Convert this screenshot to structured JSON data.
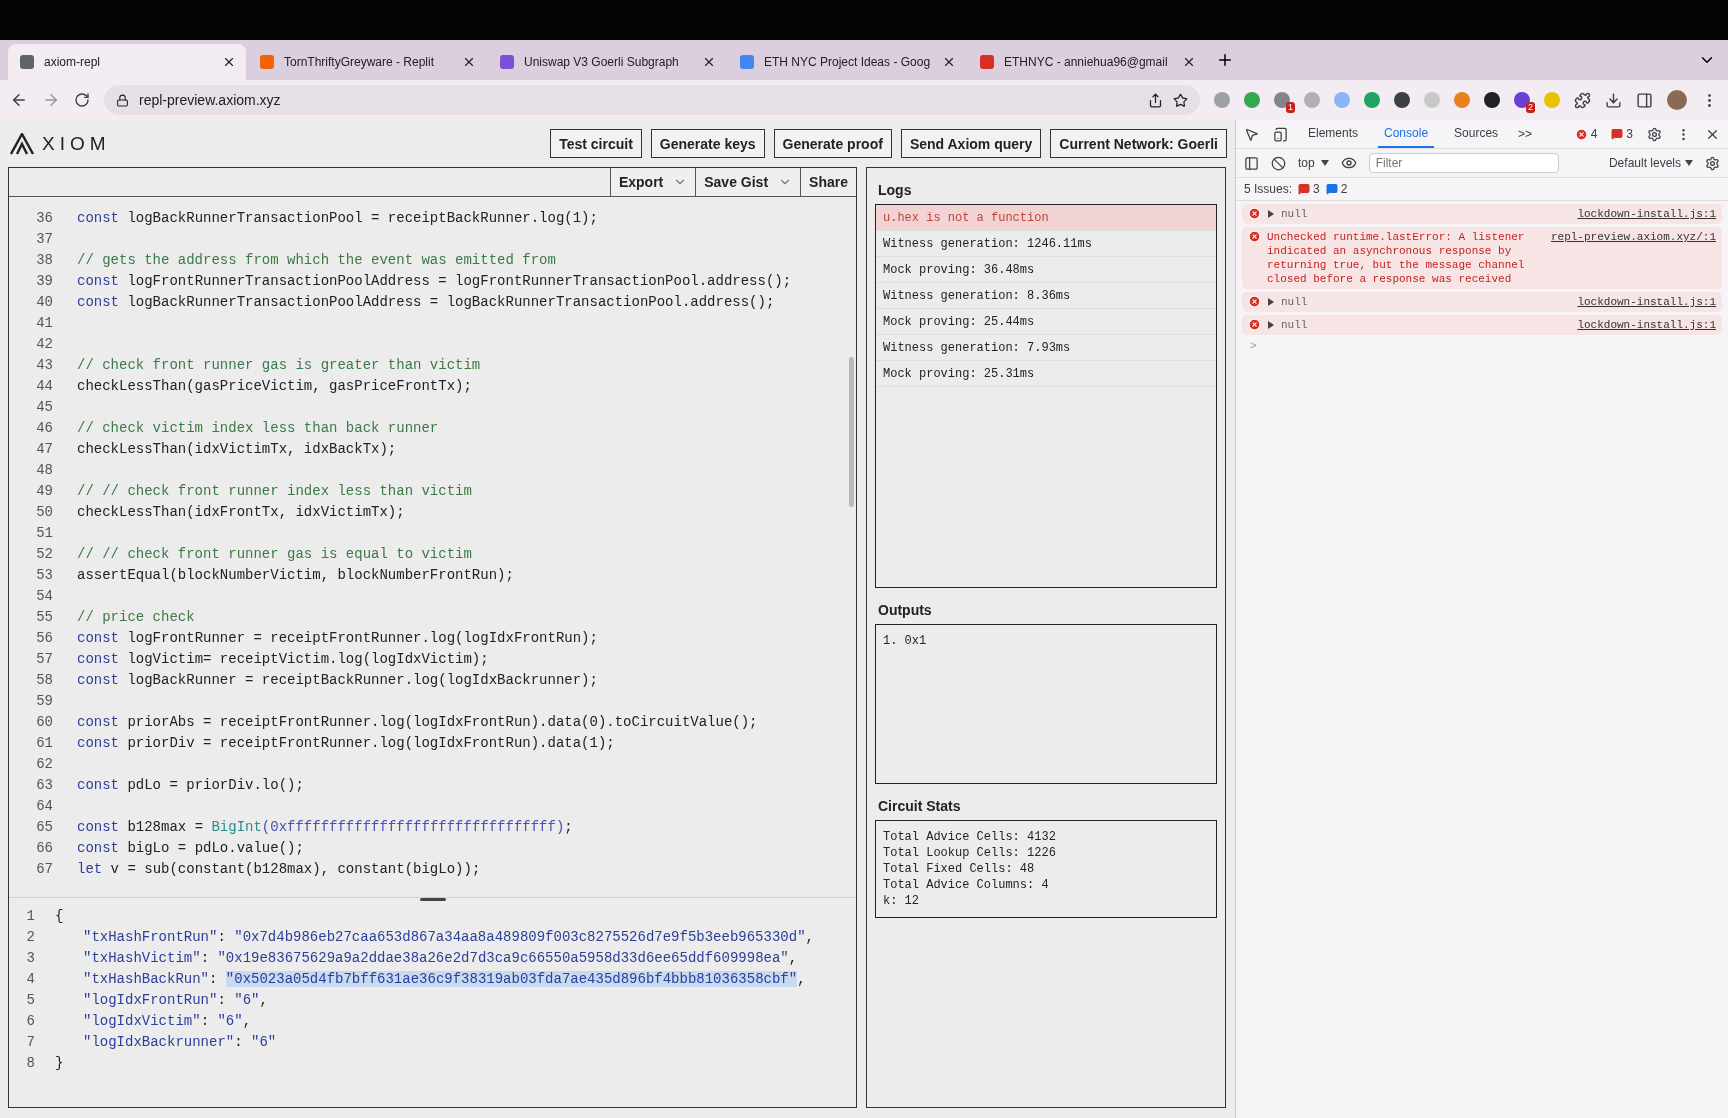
{
  "browser": {
    "tabs": [
      {
        "title": "axiom-repl",
        "selected": true,
        "color": "#5f6368"
      },
      {
        "title": "TornThriftyGreyware - Replit",
        "selected": false,
        "color": "#f26207"
      },
      {
        "title": "Uniswap V3 Goerli Subgraph",
        "selected": false,
        "color": "#7b4fd6"
      },
      {
        "title": "ETH NYC Project Ideas - Goog",
        "selected": false,
        "color": "#4285f4"
      },
      {
        "title": "ETHNYC - anniehua96@gmail",
        "selected": false,
        "color": "#d93025"
      }
    ],
    "url": "repl-preview.axiom.xyz",
    "extensions": [
      {
        "color": "#9aa0a6"
      },
      {
        "color": "#34a853"
      },
      {
        "color": "#80868b",
        "badge": "1"
      },
      {
        "color": "#b0b0b0"
      },
      {
        "color": "#8ab4f8"
      },
      {
        "color": "#1ea362"
      },
      {
        "color": "#3c4043"
      },
      {
        "color": "#c8c8c8"
      },
      {
        "color": "#e8821e"
      },
      {
        "color": "#202124"
      },
      {
        "color": "#6a3fd6",
        "badge": "2"
      },
      {
        "color": "#e6c200"
      }
    ]
  },
  "app": {
    "logo": "XIOM",
    "actions": [
      "Test circuit",
      "Generate keys",
      "Generate proof",
      "Send Axiom query",
      "Current Network: Goerli"
    ],
    "editor_tools": [
      {
        "label": "Export",
        "dropdown": true
      },
      {
        "label": "Save Gist",
        "dropdown": true
      },
      {
        "label": "Share",
        "dropdown": false
      }
    ],
    "code_lines": [
      {
        "num": "36",
        "tokens": [
          {
            "kind": "kw",
            "t": "const"
          },
          {
            "kind": "tx",
            "t": " logBackRunnerTransactionPool = receiptBackRunner.log(1);"
          }
        ]
      },
      {
        "num": "37"
      },
      {
        "num": "38",
        "tokens": [
          {
            "kind": "cm",
            "t": "// gets the address from which the event was emitted from"
          }
        ]
      },
      {
        "num": "39",
        "tokens": [
          {
            "kind": "kw",
            "t": "const"
          },
          {
            "kind": "tx",
            "t": " logFrontRunnerTransactionPoolAddress = logFrontRunnerTransactionPool.address();"
          }
        ]
      },
      {
        "num": "40",
        "tokens": [
          {
            "kind": "kw",
            "t": "const"
          },
          {
            "kind": "tx",
            "t": " logBackRunnerTransactionPoolAddress = logBackRunnerTransactionPool.address();"
          }
        ]
      },
      {
        "num": "41"
      },
      {
        "num": "42"
      },
      {
        "num": "43",
        "tokens": [
          {
            "kind": "cm",
            "t": "// check front runner gas is greater than victim"
          }
        ]
      },
      {
        "num": "44",
        "tokens": [
          {
            "kind": "tx",
            "t": "checkLessThan(gasPriceVictim, gasPriceFrontTx);"
          }
        ]
      },
      {
        "num": "45"
      },
      {
        "num": "46",
        "tokens": [
          {
            "kind": "cm",
            "t": "// check victim index less than back runner"
          }
        ]
      },
      {
        "num": "47",
        "tokens": [
          {
            "kind": "tx",
            "t": "checkLessThan(idxVictimTx, idxBackTx);"
          }
        ]
      },
      {
        "num": "48"
      },
      {
        "num": "49",
        "tokens": [
          {
            "kind": "cm",
            "t": "// // check front runner index less than victim"
          }
        ]
      },
      {
        "num": "50",
        "tokens": [
          {
            "kind": "tx",
            "t": "checkLessThan(idxFrontTx, idxVictimTx);"
          }
        ]
      },
      {
        "num": "51"
      },
      {
        "num": "52",
        "tokens": [
          {
            "kind": "cm",
            "t": "// // check front runner gas is equal to victim"
          }
        ]
      },
      {
        "num": "53",
        "tokens": [
          {
            "kind": "tx",
            "t": "assertEqual(blockNumberVictim, blockNumberFrontRun);"
          }
        ]
      },
      {
        "num": "54"
      },
      {
        "num": "55",
        "tokens": [
          {
            "kind": "cm",
            "t": "// price check"
          }
        ]
      },
      {
        "num": "56",
        "tokens": [
          {
            "kind": "kw",
            "t": "const"
          },
          {
            "kind": "tx",
            "t": " logFrontRunner = receiptFrontRunner.log(logIdxFrontRun);"
          }
        ]
      },
      {
        "num": "57",
        "tokens": [
          {
            "kind": "kw",
            "t": "const"
          },
          {
            "kind": "tx",
            "t": " logVictim= receiptVictim.log(logIdxVictim);"
          }
        ]
      },
      {
        "num": "58",
        "tokens": [
          {
            "kind": "kw",
            "t": "const"
          },
          {
            "kind": "tx",
            "t": " logBackRunner = receiptBackRunner.log(logIdxBackrunner);"
          }
        ]
      },
      {
        "num": "59"
      },
      {
        "num": "60",
        "tokens": [
          {
            "kind": "kw",
            "t": "const"
          },
          {
            "kind": "tx",
            "t": " priorAbs = receiptFrontRunner.log(logIdxFrontRun).data(0).toCircuitValue();"
          }
        ]
      },
      {
        "num": "61",
        "tokens": [
          {
            "kind": "kw",
            "t": "const"
          },
          {
            "kind": "tx",
            "t": " priorDiv = receiptFrontRunner.log(logIdxFrontRun).data(1);"
          }
        ]
      },
      {
        "num": "62"
      },
      {
        "num": "63",
        "tokens": [
          {
            "kind": "kw",
            "t": "const"
          },
          {
            "kind": "tx",
            "t": " pdLo = priorDiv.lo();"
          }
        ]
      },
      {
        "num": "64"
      },
      {
        "num": "65",
        "tokens": [
          {
            "kind": "kw",
            "t": "const"
          },
          {
            "kind": "tx",
            "t": " b128max = "
          },
          {
            "kind": "fn",
            "t": "BigInt"
          },
          {
            "kind": "lit",
            "t": "(0xffffffffffffffffffffffffffffffff)"
          },
          {
            "kind": "tx",
            "t": ";"
          }
        ]
      },
      {
        "num": "66",
        "tokens": [
          {
            "kind": "kw",
            "t": "const"
          },
          {
            "kind": "tx",
            "t": " bigLo = pdLo.value();"
          }
        ]
      },
      {
        "num": "67",
        "tokens": [
          {
            "kind": "kw",
            "t": "let"
          },
          {
            "kind": "tx",
            "t": " v = sub(constant(b128max), constant(bigLo));"
          }
        ]
      }
    ],
    "input_lines": [
      {
        "num": "1",
        "kind": "brace",
        "selected": false,
        "tokens": [
          {
            "kind": "tx",
            "t": "{"
          }
        ]
      },
      {
        "num": "2",
        "kind": "pair",
        "selected": false,
        "tokens": [
          {
            "kind": "key",
            "t": "\"txHashFrontRun\""
          },
          {
            "kind": "tx",
            "t": ": "
          },
          {
            "kind": "str",
            "t": "\"0x7d4b986eb27caa653d867a34aa8a489809f003c8275526d7e9f5b3eeb965330d\""
          },
          {
            "kind": "tx",
            "t": ","
          }
        ]
      },
      {
        "num": "3",
        "kind": "pair",
        "selected": false,
        "tokens": [
          {
            "kind": "key",
            "t": "\"txHashVictim\""
          },
          {
            "kind": "tx",
            "t": ": "
          },
          {
            "kind": "str",
            "t": "\"0x19e83675629a9a2ddae38a26e2d7d3ca9c66550a5958d33d6ee65ddf609998ea\""
          },
          {
            "kind": "tx",
            "t": ","
          }
        ]
      },
      {
        "num": "4",
        "kind": "pair",
        "selected": true,
        "tokens": [
          {
            "kind": "key",
            "t": "\"txHashBackRun\""
          },
          {
            "kind": "tx",
            "t": ": "
          },
          {
            "kind": "str",
            "t": "\"0x5023a05d4fb7bff631ae36c9f38319ab03fda7ae435d896bf4bbb81036358cbf\""
          },
          {
            "kind": "tx",
            "t": ","
          }
        ]
      },
      {
        "num": "5",
        "kind": "pair",
        "selected": false,
        "tokens": [
          {
            "kind": "key",
            "t": "\"logIdxFrontRun\""
          },
          {
            "kind": "tx",
            "t": ": "
          },
          {
            "kind": "str",
            "t": "\"6\""
          },
          {
            "kind": "tx",
            "t": ","
          }
        ]
      },
      {
        "num": "6",
        "kind": "pair",
        "selected": false,
        "tokens": [
          {
            "kind": "key",
            "t": "\"logIdxVictim\""
          },
          {
            "kind": "tx",
            "t": ": "
          },
          {
            "kind": "str",
            "t": "\"6\""
          },
          {
            "kind": "tx",
            "t": ","
          }
        ]
      },
      {
        "num": "7",
        "kind": "pair",
        "selected": false,
        "tokens": [
          {
            "kind": "key",
            "t": "\"logIdxBackrunner\""
          },
          {
            "kind": "tx",
            "t": ": "
          },
          {
            "kind": "str",
            "t": "\"6\""
          }
        ]
      },
      {
        "num": "8",
        "kind": "brace",
        "selected": false,
        "tokens": [
          {
            "kind": "tx",
            "t": "}"
          }
        ]
      }
    ],
    "logs": {
      "title": "Logs",
      "entries": [
        {
          "text": "u.hex is not a function",
          "kind": "error"
        },
        {
          "text": "Witness generation: 1246.11ms",
          "kind": "info"
        },
        {
          "text": "Mock proving: 36.48ms",
          "kind": "info"
        },
        {
          "text": "Witness generation: 8.36ms",
          "kind": "info"
        },
        {
          "text": "Mock proving: 25.44ms",
          "kind": "info"
        },
        {
          "text": "Witness generation: 7.93ms",
          "kind": "info"
        },
        {
          "text": "Mock proving: 25.31ms",
          "kind": "info"
        }
      ]
    },
    "outputs": {
      "title": "Outputs",
      "items": [
        "1. 0x1"
      ]
    },
    "circuit_stats": {
      "title": "Circuit Stats",
      "lines": [
        "Total Advice Cells: 4132",
        "Total Lookup Cells: 1226",
        "Total Fixed Cells: 48",
        "Total Advice Columns: 4",
        "k: 12"
      ]
    }
  },
  "devtools": {
    "tabs": [
      {
        "label": "Elements",
        "selected": false
      },
      {
        "label": "Console",
        "selected": true
      },
      {
        "label": "Sources",
        "selected": false
      }
    ],
    "more": ">>",
    "error_count": "4",
    "issue_count": "3",
    "context": "top",
    "filter_placeholder": "Filter",
    "levels": "Default levels",
    "issues_label": "5 Issues:",
    "issues_errors": "3",
    "issues_info": "2",
    "messages": [
      {
        "kind": "collapsed",
        "text": "null",
        "source": "lockdown-install.js:1"
      },
      {
        "kind": "message",
        "text": "Unchecked runtime.lastError: A listener indicated an asynchronous response by returning true, but the message channel closed before a response was received",
        "source": "repl-preview.axiom.xyz/:1"
      },
      {
        "kind": "collapsed",
        "text": "null",
        "source": "lockdown-install.js:1"
      },
      {
        "kind": "collapsed",
        "text": "null",
        "source": "lockdown-install.js:1"
      }
    ],
    "prompt": ">"
  }
}
